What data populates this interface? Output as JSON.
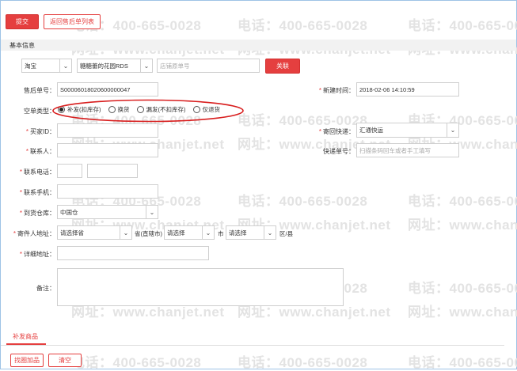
{
  "toolbar": {
    "submit_label": "提交",
    "back_label": "返回售后单列表"
  },
  "section": {
    "basic_info": "基本信息",
    "reissue_goods": "补发商品"
  },
  "top_row": {
    "platform": "淘宝",
    "store": "糖糖蕾的花园RDS",
    "order_placeholder": "店铺原单号",
    "link_label": "关联"
  },
  "fields": {
    "after_sale_no_label": "售后单号：",
    "after_sale_no_value": "S00006018020600000047",
    "created_time_label": "新建时间：",
    "created_time_value": "2018-02-06 14:10:59",
    "empty_type_label": "空单类型：",
    "buyer_id_label": "买家ID：",
    "return_express_label": "寄回快递：",
    "return_express_value": "汇通快运",
    "contact_label": "联系人：",
    "express_no_label": "快递单号：",
    "express_no_placeholder": "扫描条码回车或者手工填写",
    "phone_label": "联系电话：",
    "mobile_label": "联系手机：",
    "warehouse_label": "到货仓库：",
    "warehouse_value": "中国仓",
    "sender_addr_label": "寄件人地址：",
    "province_value": "请选择省",
    "province_suffix": "省(直辖市)",
    "city_value": "请选择",
    "city_suffix": "市",
    "district_value": "请选择",
    "district_suffix": "区/县",
    "detail_addr_label": "详细地址：",
    "remark_label": "备注："
  },
  "radio_options": [
    {
      "label": "补发(扣库存)",
      "checked": true
    },
    {
      "label": "换货",
      "checked": false
    },
    {
      "label": "漏发(不扣库存)",
      "checked": false
    },
    {
      "label": "仅退货",
      "checked": false
    }
  ],
  "bottom": {
    "add_goods_label": "找圈加品",
    "clear_label": "清空"
  },
  "watermark": {
    "phone": "电话：400-665-0028",
    "site": "网址：www.chanjet.net"
  },
  "colors": {
    "accent": "#e53f3f",
    "ellipse": "#d81e1e"
  }
}
